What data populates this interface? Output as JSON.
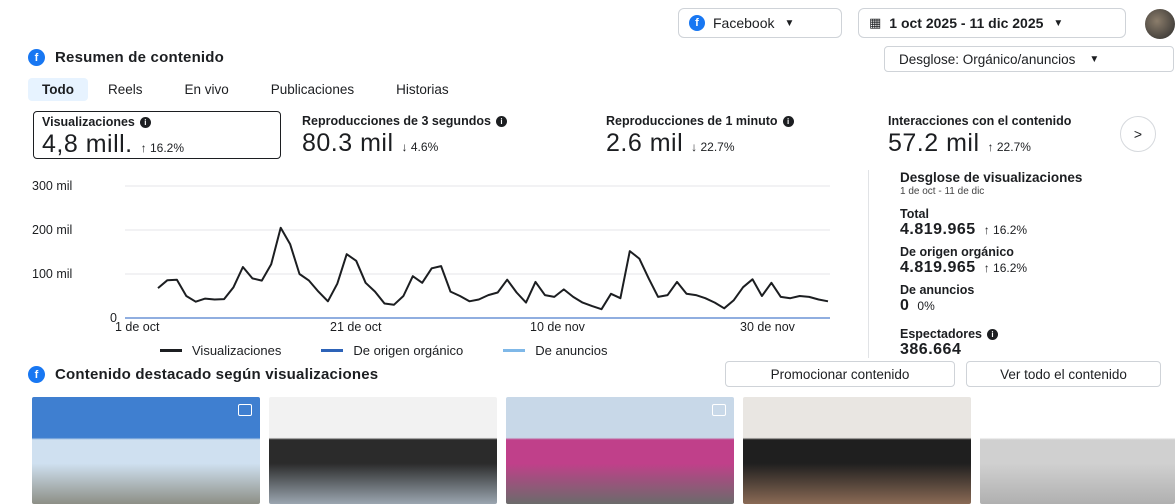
{
  "topbar": {
    "platform": "Facebook",
    "date_range": "1 oct 2025 - 11 dic 2025"
  },
  "summary": {
    "title": "Resumen de contenido",
    "breakdown": "Desglose: Orgánico/anuncios",
    "tabs": [
      "Todo",
      "Reels",
      "En vivo",
      "Publicaciones",
      "Historias"
    ],
    "active_tab": "Todo"
  },
  "metrics": [
    {
      "label": "Visualizaciones",
      "value": "4,8 mill.",
      "delta": "↑ 16.2%"
    },
    {
      "label": "Reproducciones de 3 segundos",
      "value": "80.3 mil",
      "delta": "↓ 4.6%"
    },
    {
      "label": "Reproducciones de 1 minuto",
      "value": "2.6 mil",
      "delta": "↓ 22.7%"
    },
    {
      "label": "Interacciones con el contenido",
      "value": "57.2 mil",
      "delta": "↑ 22.7%"
    }
  ],
  "chart_data": {
    "type": "line",
    "y_ticks": [
      "300 mil",
      "200 mil",
      "100 mil",
      "0"
    ],
    "x_ticks": [
      "1 de oct",
      "21 de oct",
      "10 de nov",
      "30 de nov"
    ],
    "ylim": [
      0,
      300000
    ],
    "grid": true,
    "legend_position": "bottom",
    "series": [
      {
        "name": "Visualizaciones",
        "color": "#1c1e21",
        "values": [
          68000,
          86000,
          87000,
          50000,
          37000,
          44000,
          42000,
          43000,
          70000,
          116000,
          90000,
          85000,
          122000,
          205000,
          168000,
          100000,
          85000,
          60000,
          38000,
          78000,
          145000,
          130000,
          80000,
          60000,
          33000,
          30000,
          50000,
          95000,
          80000,
          113000,
          118000,
          60000,
          50000,
          38000,
          42000,
          52000,
          58000,
          87000,
          58000,
          35000,
          82000,
          52000,
          48000,
          65000,
          48000,
          35000,
          27000,
          20000,
          55000,
          45000,
          152000,
          135000,
          90000,
          48000,
          52000,
          82000,
          55000,
          52000,
          45000,
          35000,
          22000,
          40000,
          70000,
          88000,
          50000,
          80000,
          48000,
          45000,
          50000,
          48000,
          42000,
          38000
        ]
      },
      {
        "name": "De origen orgánico",
        "color": "#2d63b8",
        "values": []
      },
      {
        "name": "De anuncios",
        "color": "#7fb8e8",
        "values": []
      }
    ]
  },
  "breakdown_panel": {
    "title": "Desglose de visualizaciones",
    "range": "1 de oct - 11 de dic",
    "total_label": "Total",
    "total_value": "4.819.965",
    "total_delta": "↑ 16.2%",
    "organic_label": "De origen orgánico",
    "organic_value": "4.819.965",
    "organic_delta": "↑ 16.2%",
    "ads_label": "De anuncios",
    "ads_value": "0",
    "ads_delta": "0%",
    "viewers_label": "Espectadores",
    "viewers_value": "386.664"
  },
  "featured": {
    "title": "Contenido destacado según visualizaciones",
    "promote": "Promocionar contenido",
    "view_all": "Ver todo el contenido",
    "thumbs": [
      {
        "colors": [
          "#3f7fd0",
          "#cfe0f0",
          "#8d8f86"
        ]
      },
      {
        "colors": [
          "#f2f2f2",
          "#2b2b2b",
          "#9ba6b0"
        ]
      },
      {
        "colors": [
          "#c8d8e8",
          "#c0408a",
          "#6b6b6b"
        ]
      },
      {
        "colors": [
          "#e9e6e2",
          "#1f1f1f",
          "#8a6a55"
        ]
      },
      {
        "colors": [
          "#ffffff",
          "#d0d0d0",
          "#b0b0b0"
        ]
      }
    ]
  }
}
